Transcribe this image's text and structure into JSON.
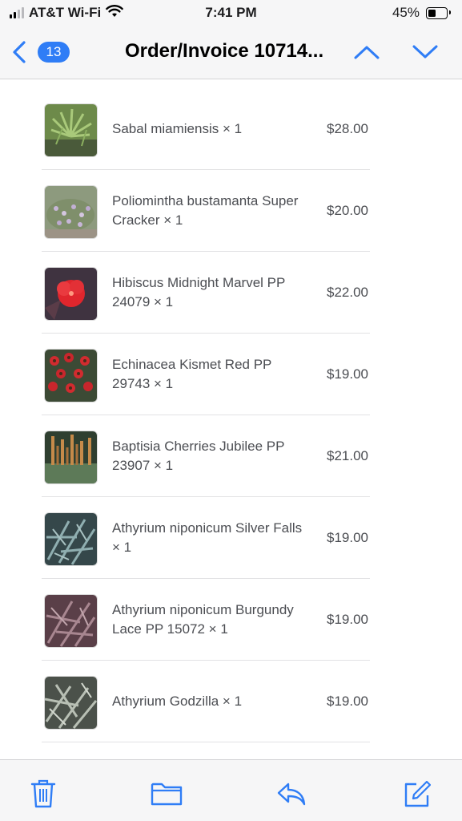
{
  "status_bar": {
    "carrier": "AT&T Wi-Fi",
    "time": "7:41 PM",
    "battery": "45%",
    "battery_level": 0.45,
    "icons": [
      "signal-icon",
      "wifi-icon",
      "battery-icon"
    ]
  },
  "nav": {
    "back_icon": "chevron-left-icon",
    "badge_count": "13",
    "title": "Order/Invoice 10714...",
    "previous_icon": "chevron-up-icon",
    "next_icon": "chevron-down-icon"
  },
  "items": [
    {
      "name": "Sabal miamiensis × 1",
      "price": "$28.00",
      "image": "palm-photo"
    },
    {
      "name": "Poliomintha bustamanta Super Cracker × 1",
      "price": "$20.00",
      "image": "shrub-photo"
    },
    {
      "name": "Hibiscus Midnight Marvel PP 24079 × 1",
      "price": "$22.00",
      "image": "red-hibiscus-photo"
    },
    {
      "name": "Echinacea Kismet Red PP 29743 × 1",
      "price": "$19.00",
      "image": "red-coneflower-photo"
    },
    {
      "name": "Baptisia Cherries Jubilee PP 23907 × 1",
      "price": "$21.00",
      "image": "baptisia-photo"
    },
    {
      "name": "Athyrium niponicum Silver Falls × 1",
      "price": "$19.00",
      "image": "silver-fern-photo"
    },
    {
      "name": "Athyrium niponicum Burgundy Lace PP 15072 × 1",
      "price": "$19.00",
      "image": "burgundy-fern-photo"
    },
    {
      "name": "Athyrium Godzilla × 1",
      "price": "$19.00",
      "image": "godzilla-fern-photo"
    }
  ],
  "toolbar": {
    "icons": [
      "trash-icon",
      "folder-icon",
      "reply-icon",
      "compose-icon"
    ]
  },
  "colors": {
    "accent": "#2f7df6",
    "bar_background": "#f6f6f7",
    "text_secondary": "#4b4d52"
  }
}
